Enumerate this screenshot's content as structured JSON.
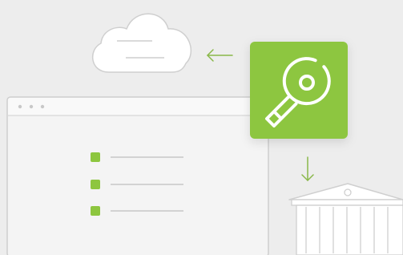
{
  "illustration": {
    "colors": {
      "background": "#ededed",
      "accent_green": "#8dc63f",
      "arrow_green": "#8ab84a",
      "outline": "#cfcfcf",
      "panel_fill": "#f4f4f4",
      "titlebar_fill": "#f9f9f9",
      "white": "#ffffff",
      "rule": "#bdbdbd",
      "dot": "#c8c8c8"
    },
    "elements": {
      "cloud": {
        "icon": "cloud-icon",
        "text_lines": 2
      },
      "key_badge": {
        "icon": "key-icon"
      },
      "browser_window": {
        "control_dots": 3,
        "list_items": 3
      },
      "bank": {
        "icon": "bank-building-icon",
        "columns": 6
      },
      "arrows": [
        "arrow-left-icon",
        "arrow-down-icon"
      ]
    }
  }
}
